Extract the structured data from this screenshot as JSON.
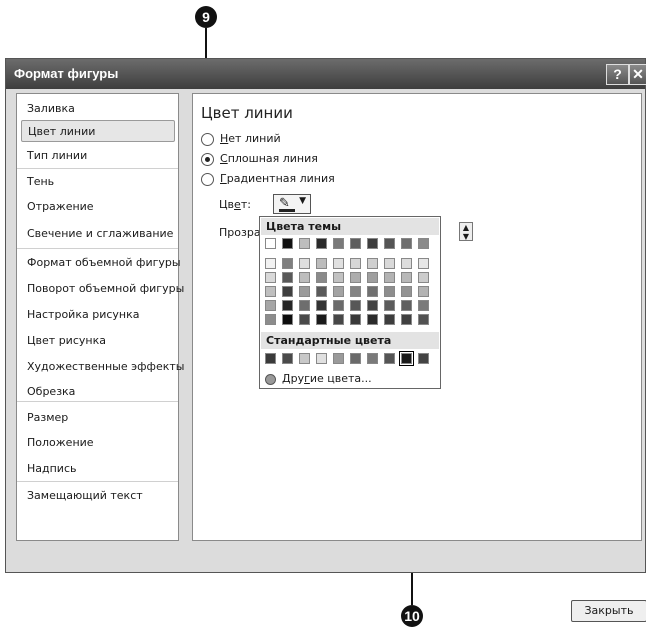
{
  "callouts": {
    "top": "9",
    "bottom": "10"
  },
  "dialog": {
    "title": "Формат фигуры",
    "help_label": "?",
    "close_label": "✕",
    "close_button_label": "Закрыть"
  },
  "nav": {
    "items": [
      {
        "label": "Заливка",
        "selected": false
      },
      {
        "label": "Цвет линии",
        "selected": true
      },
      {
        "label": "Тип линии",
        "selected": false
      },
      {
        "label": "Тень",
        "selected": false
      },
      {
        "label": "Отражение",
        "selected": false
      },
      {
        "label": "Свечение и сглаживание",
        "selected": false
      },
      {
        "label": "Формат объемной фигуры",
        "selected": false
      },
      {
        "label": "Поворот объемной фигуры",
        "selected": false
      },
      {
        "label": "Настройка рисунка",
        "selected": false
      },
      {
        "label": "Цвет рисунка",
        "selected": false
      },
      {
        "label": "Художественные эффекты",
        "selected": false
      },
      {
        "label": "Обрезка",
        "selected": false
      },
      {
        "label": "Размер",
        "selected": false
      },
      {
        "label": "Положение",
        "selected": false
      },
      {
        "label": "Надпись",
        "selected": false
      },
      {
        "label": "Замещающий текст",
        "selected": false
      }
    ]
  },
  "panel": {
    "title": "Цвет линии",
    "options": [
      {
        "accel": "Н",
        "rest": "ет линий",
        "checked": false
      },
      {
        "accel": "С",
        "rest": "плошная линия",
        "checked": true
      },
      {
        "accel": "Г",
        "rest": "радиентная линия",
        "checked": false
      }
    ],
    "color_label": "Цвет:",
    "color_accel_pre": "Цв",
    "color_accel": "е",
    "color_accel_post": "т:",
    "transparency_label": "Прозрач",
    "color_icon": "pen-fill-icon"
  },
  "palette": {
    "theme_header": "Цвета темы",
    "standard_header": "Стандартные цвета",
    "more_colors_pre": "Дру",
    "more_colors_accel": "г",
    "more_colors_post": "ие цвета...",
    "theme_top_row": [
      "#ffffff",
      "#111111",
      "#bdbdbd",
      "#2a2a2a",
      "#7a7a7a",
      "#5e5e5e",
      "#3d3d3d",
      "#555555",
      "#6e6e6e",
      "#8a8a8a"
    ],
    "theme_columns": [
      [
        "#f2f2f2",
        "#d9d9d9",
        "#bfbfbf",
        "#a6a6a6",
        "#8c8c8c"
      ],
      [
        "#7f7f7f",
        "#595959",
        "#3f3f3f",
        "#262626",
        "#0d0d0d"
      ],
      [
        "#dedede",
        "#bdbdbd",
        "#9b9b9b",
        "#6e6e6e",
        "#4a4a4a"
      ],
      [
        "#bcbcbc",
        "#8a8a8a",
        "#5a5a5a",
        "#333333",
        "#1a1a1a"
      ],
      [
        "#e0e0e0",
        "#c2c2c2",
        "#a3a3a3",
        "#6b6b6b",
        "#474747"
      ],
      [
        "#d6d6d6",
        "#adadad",
        "#848484",
        "#575757",
        "#3a3a3a"
      ],
      [
        "#cfcfcf",
        "#9f9f9f",
        "#707070",
        "#434343",
        "#2b2b2b"
      ],
      [
        "#d9d9d9",
        "#b3b3b3",
        "#8d8d8d",
        "#5c5c5c",
        "#3d3d3d"
      ],
      [
        "#dcdcdc",
        "#b8b8b8",
        "#939393",
        "#5f5f5f",
        "#404040"
      ],
      [
        "#e6e6e6",
        "#cccccc",
        "#b3b3b3",
        "#7a7a7a",
        "#525252"
      ]
    ],
    "standard_row": [
      "#3a3a3a",
      "#4a4a4a",
      "#c8c8c8",
      "#e0e0e0",
      "#9a9a9a",
      "#6a6a6a",
      "#7a7a7a",
      "#555555",
      "#1a1a1a",
      "#444444"
    ],
    "standard_selected_index": 8
  }
}
